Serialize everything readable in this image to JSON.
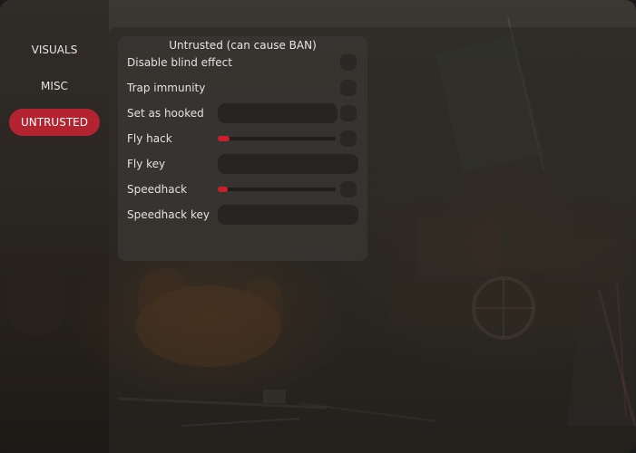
{
  "sidebar": {
    "items": [
      {
        "label": "VISUALS",
        "active": false
      },
      {
        "label": "MISC",
        "active": false
      },
      {
        "label": "UNTRUSTED",
        "active": true
      }
    ]
  },
  "panel": {
    "title": "Untrusted (can cause BAN)",
    "rows": {
      "disable_blind": {
        "label": "Disable blind effect",
        "checked": false
      },
      "trap_immunity": {
        "label": "Trap immunity",
        "checked": false
      },
      "set_hooked": {
        "label": "Set as hooked",
        "value": "",
        "checked": false
      },
      "fly_hack": {
        "label": "Fly hack",
        "value_fraction": 0.1,
        "checked": false
      },
      "fly_key": {
        "label": "Fly key",
        "value": ""
      },
      "speedhack": {
        "label": "Speedhack",
        "value_fraction": 0.085,
        "checked": false
      },
      "speedhack_key": {
        "label": "Speedhack key",
        "value": ""
      }
    }
  },
  "colors": {
    "accent": "#b32430",
    "slider_fill": "#cc1f2c",
    "panel": "#3a3835",
    "text": "#e2e2e2"
  }
}
